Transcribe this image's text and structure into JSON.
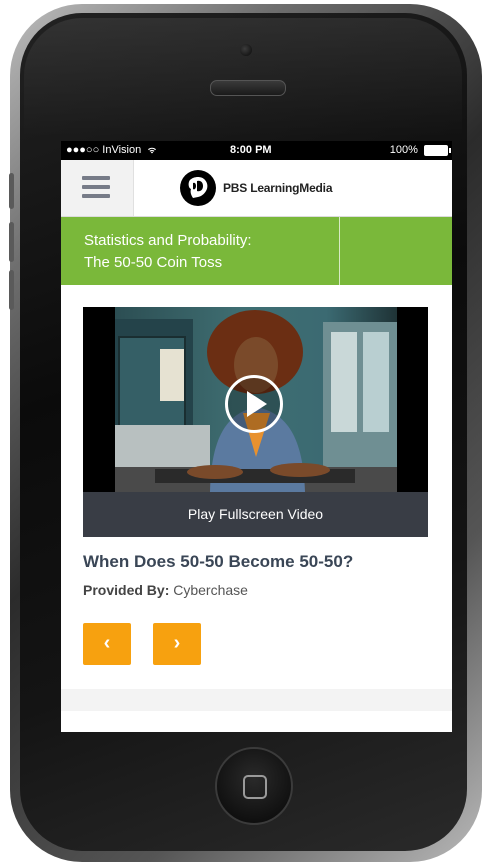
{
  "status_bar": {
    "carrier": "●●●○○ InVision",
    "time": "8:00 PM",
    "battery": "100%"
  },
  "header": {
    "logo_text": "PBS LearningMedia",
    "logo_icon": "pbs-head-icon",
    "menu_icon": "hamburger-icon"
  },
  "title_bar": {
    "line1": "Statistics and Probability:",
    "line2": "The 50-50 Coin Toss"
  },
  "video": {
    "fullscreen_label": "Play Fullscreen Video",
    "play_icon": "play-icon"
  },
  "content": {
    "video_title": "When Does 50-50 Become 50-50?",
    "provided_label": "Provided By:",
    "provided_value": "Cyberchase"
  },
  "nav": {
    "prev_label": "‹",
    "next_label": "›"
  },
  "colors": {
    "accent_green": "#7ab83a",
    "button_orange": "#f7a10f",
    "fullscreen_bar": "#393d45",
    "title_text": "#3a4656"
  }
}
